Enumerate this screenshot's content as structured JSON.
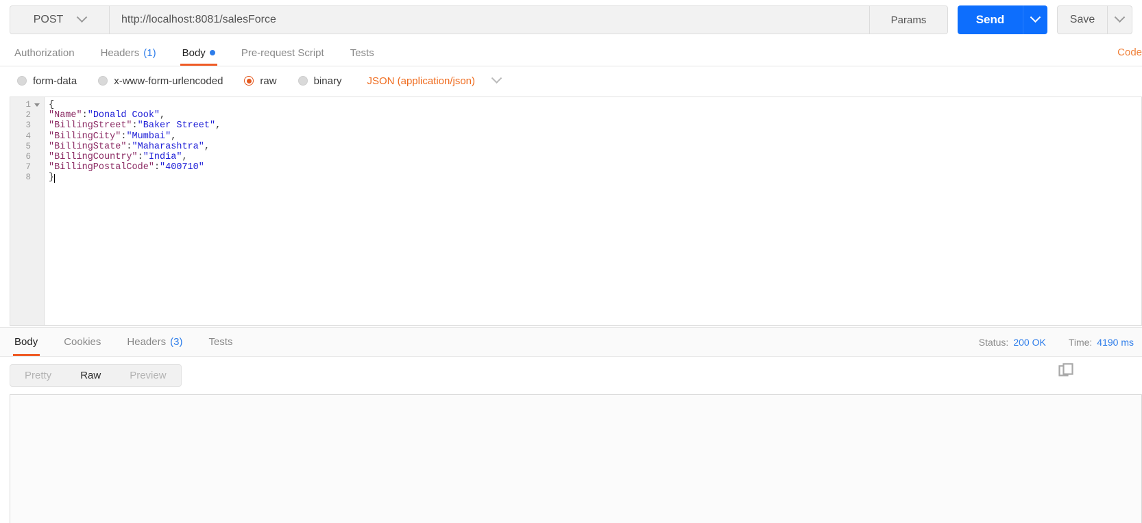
{
  "request_bar": {
    "method": "POST",
    "method_caret_icon": "chevron-down-icon",
    "url": "http://localhost:8081/salesForce",
    "url_placeholder": "Enter request URL",
    "params_label": "Params",
    "send_label": "Send",
    "send_caret_icon": "chevron-down-icon",
    "save_label": "Save",
    "save_caret_icon": "chevron-down-icon"
  },
  "request_tabs": {
    "items": [
      {
        "label": "Authorization",
        "count": "",
        "dot": false,
        "active": false
      },
      {
        "label": "Headers",
        "count": "(1)",
        "dot": false,
        "active": false
      },
      {
        "label": "Body",
        "count": "",
        "dot": true,
        "active": true
      },
      {
        "label": "Pre-request Script",
        "count": "",
        "dot": false,
        "active": false
      },
      {
        "label": "Tests",
        "count": "",
        "dot": false,
        "active": false
      }
    ],
    "code_link": "Code"
  },
  "body_type": {
    "options": [
      {
        "label": "form-data",
        "checked": false
      },
      {
        "label": "x-www-form-urlencoded",
        "checked": false
      },
      {
        "label": "raw",
        "checked": true
      },
      {
        "label": "binary",
        "checked": false
      }
    ],
    "content_type": "JSON (application/json)",
    "content_type_caret_icon": "chevron-down-icon"
  },
  "editor": {
    "line_numbers": [
      "1",
      "2",
      "3",
      "4",
      "5",
      "6",
      "7",
      "8"
    ],
    "fold_line": 1,
    "fold_icon": "triangle-down-icon",
    "lines": [
      {
        "text": "{",
        "segments": [
          {
            "t": "{",
            "c": "p"
          }
        ]
      },
      {
        "text": "\"Name\":\"Donald Cook\",",
        "segments": [
          {
            "t": "\"Name\"",
            "c": "k"
          },
          {
            "t": ":",
            "c": "p"
          },
          {
            "t": "\"Donald Cook\"",
            "c": "v"
          },
          {
            "t": ",",
            "c": "p"
          }
        ]
      },
      {
        "text": "\"BillingStreet\":\"Baker Street\",",
        "segments": [
          {
            "t": "\"BillingStreet\"",
            "c": "k"
          },
          {
            "t": ":",
            "c": "p"
          },
          {
            "t": "\"Baker Street\"",
            "c": "v"
          },
          {
            "t": ",",
            "c": "p"
          }
        ]
      },
      {
        "text": "\"BillingCity\":\"Mumbai\",",
        "segments": [
          {
            "t": "\"BillingCity\"",
            "c": "k"
          },
          {
            "t": ":",
            "c": "p"
          },
          {
            "t": "\"Mumbai\"",
            "c": "v"
          },
          {
            "t": ",",
            "c": "p"
          }
        ]
      },
      {
        "text": "\"BillingState\":\"Maharashtra\",",
        "segments": [
          {
            "t": "\"BillingState\"",
            "c": "k"
          },
          {
            "t": ":",
            "c": "p"
          },
          {
            "t": "\"Maharashtra\"",
            "c": "v"
          },
          {
            "t": ",",
            "c": "p"
          }
        ]
      },
      {
        "text": "\"BillingCountry\":\"India\",",
        "segments": [
          {
            "t": "\"BillingCountry\"",
            "c": "k"
          },
          {
            "t": ":",
            "c": "p"
          },
          {
            "t": "\"India\"",
            "c": "v"
          },
          {
            "t": ",",
            "c": "p"
          }
        ]
      },
      {
        "text": "\"BillingPostalCode\":\"400710\"",
        "segments": [
          {
            "t": "\"BillingPostalCode\"",
            "c": "k"
          },
          {
            "t": ":",
            "c": "p"
          },
          {
            "t": "\"400710\"",
            "c": "v"
          }
        ]
      },
      {
        "text": "}",
        "segments": [
          {
            "t": "}",
            "c": "p"
          }
        ]
      }
    ],
    "raw_json": "{\n\"Name\":\"Donald Cook\",\n\"BillingStreet\":\"Baker Street\",\n\"BillingCity\":\"Mumbai\",\n\"BillingState\":\"Maharashtra\",\n\"BillingCountry\":\"India\",\n\"BillingPostalCode\":\"400710\"\n}"
  },
  "response": {
    "tabs": [
      {
        "label": "Body",
        "count": "",
        "active": true
      },
      {
        "label": "Cookies",
        "count": "",
        "active": false
      },
      {
        "label": "Headers",
        "count": "(3)",
        "active": false
      },
      {
        "label": "Tests",
        "count": "",
        "active": false
      }
    ],
    "status_label": "Status:",
    "status_value": "200 OK",
    "time_label": "Time:",
    "time_value": "4190 ms",
    "format_options": [
      {
        "label": "Pretty",
        "active": false
      },
      {
        "label": "Raw",
        "active": true
      },
      {
        "label": "Preview",
        "active": false
      }
    ],
    "copy_icon": "copy-icon",
    "body_text": ""
  },
  "colors": {
    "accent_orange": "#ef5b25",
    "accent_blue": "#0d6efd",
    "link_blue": "#2e7dea",
    "json_key": "#8b2a63",
    "json_value": "#1a1ad6",
    "content_type_orange": "#ef6c1f"
  }
}
